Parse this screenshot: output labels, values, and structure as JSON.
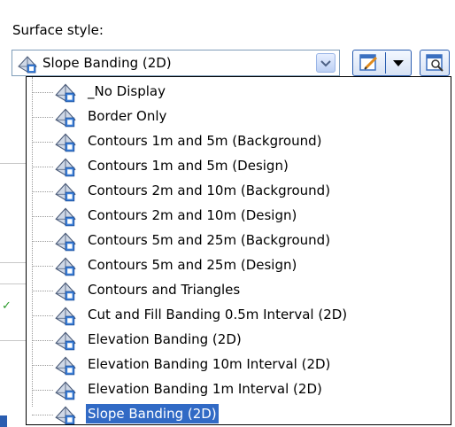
{
  "surface_style": {
    "label": "Surface style:",
    "selected": "Slope Banding (2D)"
  },
  "list": {
    "items": [
      {
        "label": "_No Display"
      },
      {
        "label": "Border Only"
      },
      {
        "label": "Contours 1m and 5m (Background)"
      },
      {
        "label": "Contours 1m and 5m (Design)"
      },
      {
        "label": "Contours 2m and 10m (Background)"
      },
      {
        "label": "Contours 2m and 10m (Design)"
      },
      {
        "label": "Contours 5m and 25m (Background)"
      },
      {
        "label": "Contours 5m and 25m (Design)"
      },
      {
        "label": "Contours and Triangles"
      },
      {
        "label": "Cut and Fill Banding 0.5m Interval (2D)"
      },
      {
        "label": "Elevation Banding (2D)"
      },
      {
        "label": "Elevation Banding 10m Interval (2D)"
      },
      {
        "label": "Elevation Banding 1m Interval (2D)"
      },
      {
        "label": "Slope Banding (2D)"
      }
    ],
    "selected_index": 13
  },
  "icons": {
    "surface_style": "surface-style-icon",
    "edit": "edit-style-icon",
    "dropdown": "chevron-down-icon",
    "details": "style-details-icon"
  },
  "colors": {
    "selection": "#316ac5",
    "border": "#7f9db9"
  }
}
